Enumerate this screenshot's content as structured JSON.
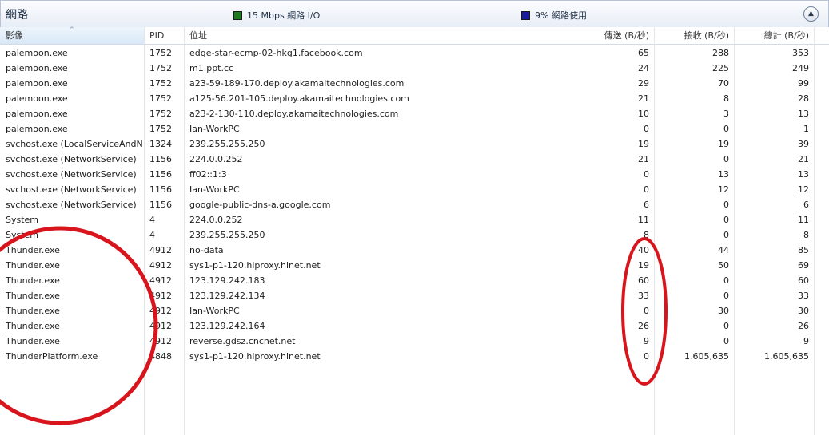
{
  "panel": {
    "title": "網路",
    "io_legend": "15 Mbps 網路 I/O",
    "io_color": "#1f7a1f",
    "usage_legend": "9% 網路使用",
    "usage_color": "#1a1a9e",
    "collapse_icon": "chevron-up-icon"
  },
  "columns": [
    "影像",
    "PID",
    "位址",
    "傳送 (B/秒)",
    "接收 (B/秒)",
    "總計 (B/秒)"
  ],
  "rows": [
    {
      "image": "palemoon.exe",
      "pid": "1752",
      "address": "edge-star-ecmp-02-hkg1.facebook.com",
      "send": "65",
      "recv": "288",
      "total": "353"
    },
    {
      "image": "palemoon.exe",
      "pid": "1752",
      "address": "m1.ppt.cc",
      "send": "24",
      "recv": "225",
      "total": "249"
    },
    {
      "image": "palemoon.exe",
      "pid": "1752",
      "address": "a23-59-189-170.deploy.akamaitechnologies.com",
      "send": "29",
      "recv": "70",
      "total": "99"
    },
    {
      "image": "palemoon.exe",
      "pid": "1752",
      "address": "a125-56.201-105.deploy.akamaitechnologies.com",
      "send": "21",
      "recv": "8",
      "total": "28"
    },
    {
      "image": "palemoon.exe",
      "pid": "1752",
      "address": "a23-2-130-110.deploy.akamaitechnologies.com",
      "send": "10",
      "recv": "3",
      "total": "13"
    },
    {
      "image": "palemoon.exe",
      "pid": "1752",
      "address": "Ian-WorkPC",
      "send": "0",
      "recv": "0",
      "total": "1"
    },
    {
      "image": "svchost.exe (LocalServiceAndN...",
      "pid": "1324",
      "address": "239.255.255.250",
      "send": "19",
      "recv": "19",
      "total": "39"
    },
    {
      "image": "svchost.exe (NetworkService)",
      "pid": "1156",
      "address": "224.0.0.252",
      "send": "21",
      "recv": "0",
      "total": "21"
    },
    {
      "image": "svchost.exe (NetworkService)",
      "pid": "1156",
      "address": "ff02::1:3",
      "send": "0",
      "recv": "13",
      "total": "13"
    },
    {
      "image": "svchost.exe (NetworkService)",
      "pid": "1156",
      "address": "Ian-WorkPC",
      "send": "0",
      "recv": "12",
      "total": "12"
    },
    {
      "image": "svchost.exe (NetworkService)",
      "pid": "1156",
      "address": "google-public-dns-a.google.com",
      "send": "6",
      "recv": "0",
      "total": "6"
    },
    {
      "image": "System",
      "pid": "4",
      "address": "224.0.0.252",
      "send": "11",
      "recv": "0",
      "total": "11"
    },
    {
      "image": "System",
      "pid": "4",
      "address": "239.255.255.250",
      "send": "8",
      "recv": "0",
      "total": "8"
    },
    {
      "image": "Thunder.exe",
      "pid": "4912",
      "address": "no-data",
      "send": "40",
      "recv": "44",
      "total": "85"
    },
    {
      "image": "Thunder.exe",
      "pid": "4912",
      "address": "sys1-p1-120.hiproxy.hinet.net",
      "send": "19",
      "recv": "50",
      "total": "69"
    },
    {
      "image": "Thunder.exe",
      "pid": "4912",
      "address": "123.129.242.183",
      "send": "60",
      "recv": "0",
      "total": "60"
    },
    {
      "image": "Thunder.exe",
      "pid": "4912",
      "address": "123.129.242.134",
      "send": "33",
      "recv": "0",
      "total": "33"
    },
    {
      "image": "Thunder.exe",
      "pid": "4912",
      "address": "Ian-WorkPC",
      "send": "0",
      "recv": "30",
      "total": "30"
    },
    {
      "image": "Thunder.exe",
      "pid": "4912",
      "address": "123.129.242.164",
      "send": "26",
      "recv": "0",
      "total": "26"
    },
    {
      "image": "Thunder.exe",
      "pid": "4912",
      "address": "reverse.gdsz.cncnet.net",
      "send": "9",
      "recv": "0",
      "total": "9"
    },
    {
      "image": "ThunderPlatform.exe",
      "pid": "4848",
      "address": "sys1-p1-120.hiproxy.hinet.net",
      "send": "0",
      "recv": "1,605,635",
      "total": "1,605,635"
    }
  ],
  "annotation": {
    "color": "#d8141c"
  }
}
